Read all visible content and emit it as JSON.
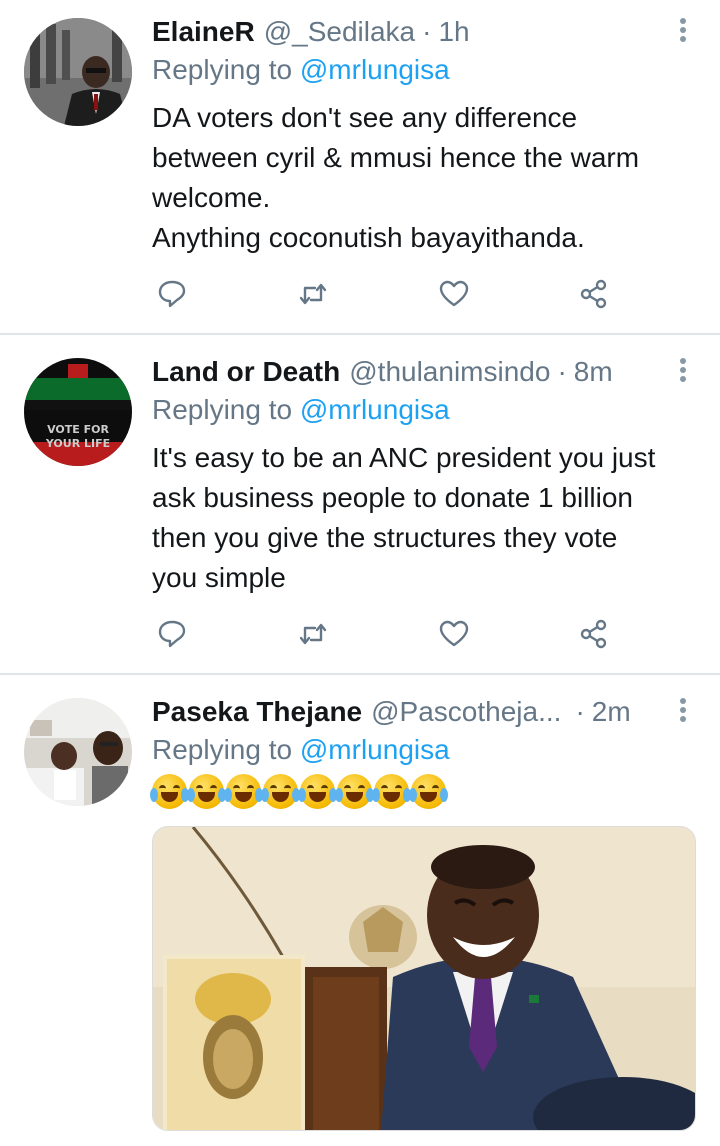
{
  "tweets": [
    {
      "display_name": "ElaineR",
      "handle": "@_Sedilaka",
      "separator": "·",
      "time": "1h",
      "replying_prefix": "Replying to",
      "replying_to": "@mrlungisa",
      "text_lines": [
        "DA voters don't see any difference",
        "between cyril & mmusi hence the warm",
        "welcome.",
        "Anything coconutish bayayithanda."
      ],
      "icons": [
        "reply-icon",
        "retweet-icon",
        "like-icon",
        "share-icon"
      ]
    },
    {
      "display_name": "Land or Death",
      "handle": "@thulanimsindo",
      "separator": "·",
      "time": "8m",
      "replying_prefix": "Replying to",
      "replying_to": "@mrlungisa",
      "text_lines": [
        "It's easy to be an ANC president you just",
        "ask business people to donate 1 billion",
        "then you give the structures they vote",
        "you simple"
      ],
      "avatar_text": [
        "VOTE FOR",
        "YOUR LIFE"
      ],
      "icons": [
        "reply-icon",
        "retweet-icon",
        "like-icon",
        "share-icon"
      ]
    },
    {
      "display_name": "Paseka Thejane",
      "handle": "@Pascotheja...",
      "separator": "·",
      "time": "2m",
      "replying_prefix": "Replying to",
      "replying_to": "@mrlungisa",
      "emoji_count": 8,
      "emoji_name": "face-with-tears-of-joy"
    }
  ],
  "colors": {
    "link": "#1da1f2",
    "muted": "#657786",
    "text": "#14171a",
    "divider": "#e1e4e6"
  }
}
